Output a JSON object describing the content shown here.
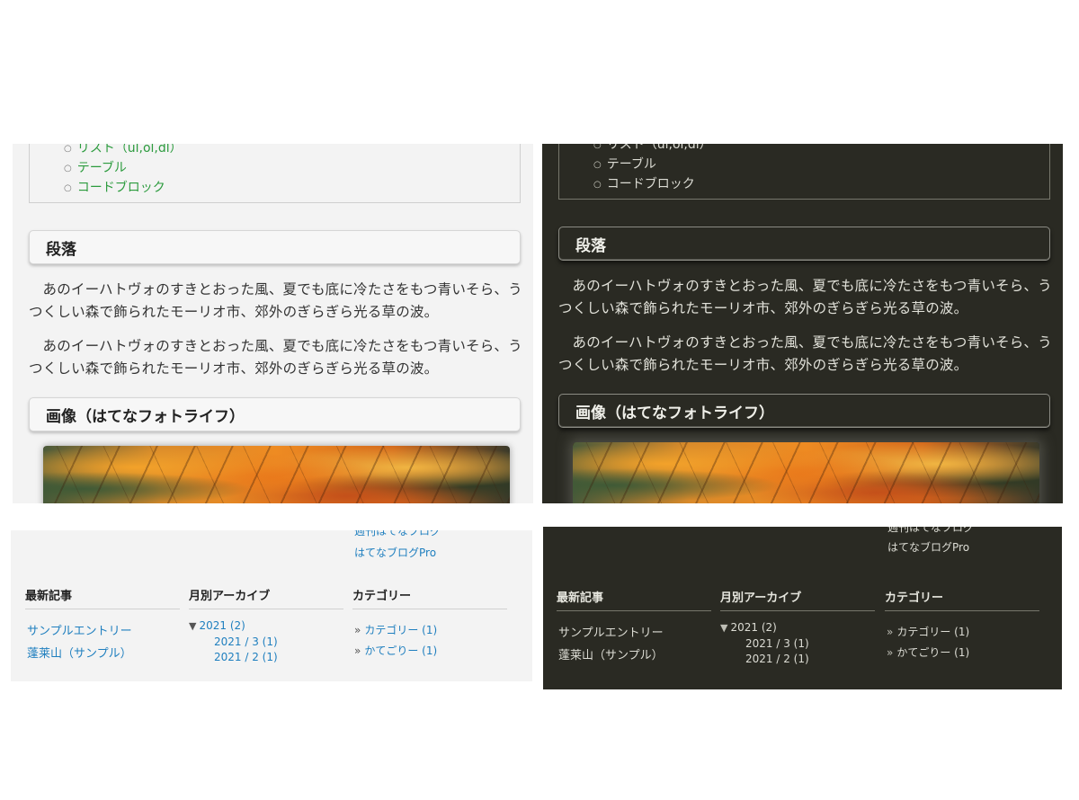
{
  "toc": {
    "items": [
      "リスト（ul,ol,dl）",
      "テーブル",
      "コードブロック"
    ]
  },
  "sections": {
    "paragraph": {
      "heading": "段落",
      "paragraphs": [
        "あのイーハトヴォのすきとおった風、夏でも底に冷たさをもつ青いそら、うつくしい森で飾られたモーリオ市、郊外のぎらぎら光る草の波。",
        "あのイーハトヴォのすきとおった風、夏でも底に冷たさをもつ青いそら、うつくしい森で飾られたモーリオ市、郊外のぎらぎら光る草の波。"
      ]
    },
    "image": {
      "heading": "画像（はてなフォトライフ）"
    }
  },
  "footer": {
    "clipped_link": "週刊はてなブログ",
    "pro_link": "はてなブログPro",
    "recent": {
      "title": "最新記事",
      "items": [
        "サンプルエントリー",
        "蓬莱山（サンプル）"
      ]
    },
    "archive": {
      "title": "月別アーカイブ",
      "toggle_icon": "▼",
      "year": "2021 (2)",
      "months": [
        "2021 / 3 (1)",
        "2021 / 2 (1)"
      ]
    },
    "categories": {
      "title": "カテゴリー",
      "bullet": "»",
      "items": [
        "カテゴリー (1)",
        "かてごりー (1)"
      ]
    }
  },
  "themes": {
    "light": {
      "background": "#f3f3f3",
      "link": "#1f7fbf",
      "toc_link": "#2c9b3e"
    },
    "dark": {
      "background": "#2a2a23",
      "text": "#dcdcd4"
    }
  }
}
